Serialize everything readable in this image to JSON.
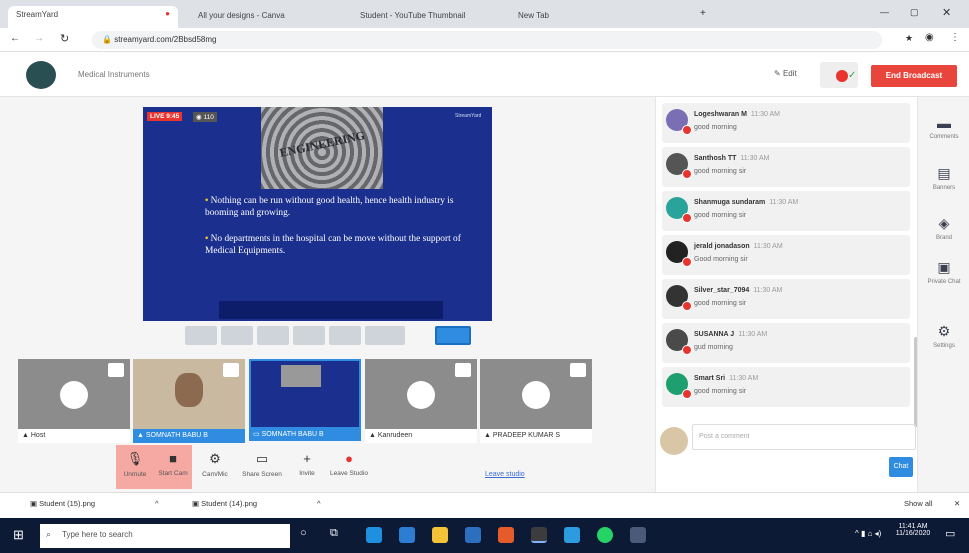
{
  "browser": {
    "tabs": [
      {
        "label": "StreamYard",
        "active": true
      },
      {
        "label": "All your designs - Canva"
      },
      {
        "label": "Student - YouTube Thumbnail"
      },
      {
        "label": "New Tab"
      }
    ],
    "url": "streamyard.com/2Bbsd58mg"
  },
  "app": {
    "broadcast_title": "Medical Instruments",
    "edit_label": "Edit",
    "end_button": "End Broadcast"
  },
  "video": {
    "live_badge": "LIVE 9:45",
    "viewers": "110",
    "watermark": "StreamYard",
    "slide_word": "ENGINEERING",
    "bullets": [
      "Nothing can be run without good health, hence health industry is booming and growing.",
      "No departments in the hospital can be move without the support of Medical Equipments."
    ]
  },
  "guests": [
    {
      "name": "Host",
      "active": false
    },
    {
      "name": "SOMNATH BABU B",
      "active": true
    },
    {
      "name": "SOMNATH BABU B",
      "active": true
    },
    {
      "name": "Kanrudeen",
      "active": false
    },
    {
      "name": "PRADEEP KUMAR S",
      "active": false
    }
  ],
  "controls": [
    {
      "label": "Unmute",
      "icon": "mic-off-icon",
      "glyph": "🎙",
      "red": true
    },
    {
      "label": "Start Cam",
      "icon": "cam-off-icon",
      "glyph": "■",
      "red": true
    },
    {
      "label": "Cam/Mic",
      "icon": "gear-icon",
      "glyph": "⚙",
      "red": false
    },
    {
      "label": "Share Screen",
      "icon": "screen-icon",
      "glyph": "▭",
      "red": false
    },
    {
      "label": "Invite",
      "icon": "add-person-icon",
      "glyph": "+",
      "red": false
    },
    {
      "label": "Leave Studio",
      "icon": "leave-icon",
      "glyph": "●",
      "red": false
    }
  ],
  "leave_link": "Leave studio",
  "chat": {
    "messages": [
      {
        "name": "Logeshwaran M",
        "time": "11:30 AM",
        "text": "good morning",
        "color": "#7a6fb5"
      },
      {
        "name": "Santhosh TT",
        "time": "11:30 AM",
        "text": "good morning sir",
        "color": "#555555"
      },
      {
        "name": "Shanmuga sundaram",
        "time": "11:30 AM",
        "text": "good morning sir",
        "color": "#2aa39a"
      },
      {
        "name": "jerald jonadason",
        "time": "11:30 AM",
        "text": "Good morning sir",
        "color": "#222222"
      },
      {
        "name": "Silver_star_7094",
        "time": "11:30 AM",
        "text": "good morning sir",
        "color": "#333333"
      },
      {
        "name": "SUSANNA J",
        "time": "11:30 AM",
        "text": "gud morning",
        "color": "#4a4a4a"
      },
      {
        "name": "Smart Sri",
        "time": "11:30 AM",
        "text": "good morning sir",
        "color": "#1f9e6f"
      }
    ],
    "placeholder": "Post a comment",
    "send_label": "Chat"
  },
  "sidebar": [
    {
      "label": "Comments",
      "icon": "comment-icon",
      "glyph": "▬"
    },
    {
      "label": "Banners",
      "icon": "banner-icon",
      "glyph": "▤"
    },
    {
      "label": "Brand",
      "icon": "palette-icon",
      "glyph": "◈"
    },
    {
      "label": "Private Chat",
      "icon": "private-chat-icon",
      "glyph": "▣"
    },
    {
      "label": "Settings",
      "icon": "gear-icon",
      "glyph": "⚙"
    }
  ],
  "downloads": {
    "files": [
      "Student (15).png",
      "Student (14).png"
    ],
    "show_all": "Show all"
  },
  "taskbar": {
    "search_placeholder": "Type here to search",
    "time": "11:41 AM",
    "date": "11/16/2020"
  },
  "colors": {
    "end_button": "#e8453c",
    "accent": "#2f8ce0",
    "taskbar": "#0c1a36"
  }
}
